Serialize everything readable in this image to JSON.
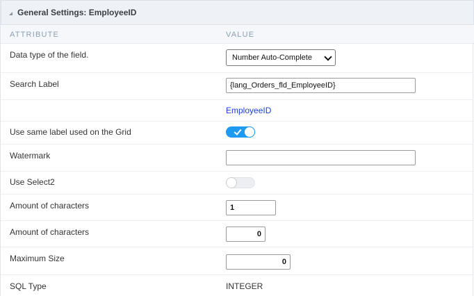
{
  "header": {
    "title": "General Settings: EmployeeID"
  },
  "columns": {
    "attribute": "ATTRIBUTE",
    "value": "VALUE"
  },
  "rows": {
    "data_type": {
      "label": "Data type of the field.",
      "selected": "Number Auto-Complete"
    },
    "search_label": {
      "label": "Search Label",
      "value": "{lang_Orders_fld_EmployeeID}"
    },
    "field_link": {
      "value": "EmployeeID"
    },
    "same_label": {
      "label": "Use same label used on the Grid",
      "state": "on"
    },
    "watermark": {
      "label": "Watermark",
      "value": ""
    },
    "select2": {
      "label": "Use Select2",
      "state": "off"
    },
    "amount1": {
      "label": "Amount of characters",
      "value": "1"
    },
    "amount2": {
      "label": "Amount of characters",
      "value": "0"
    },
    "max_size": {
      "label": "Maximum Size",
      "value": "0"
    },
    "sql_type": {
      "label": "SQL Type",
      "value": "INTEGER"
    }
  },
  "colors": {
    "accent": "#1e9af0",
    "link": "#1a3fd8",
    "header_bg": "#eef1f6"
  }
}
